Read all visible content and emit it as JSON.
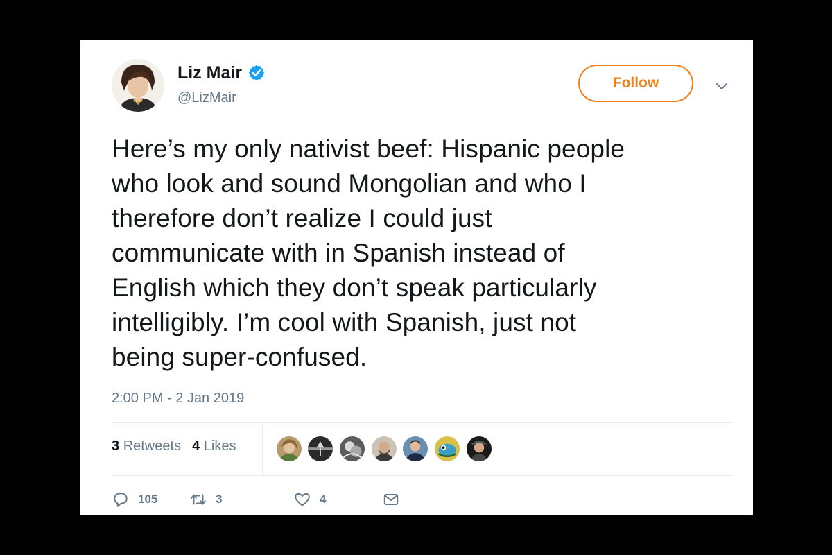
{
  "tweet": {
    "author_name": "Liz Mair",
    "handle": "@LizMair",
    "follow_label": "Follow",
    "text_lines": [
      "Here’s my only nativist beef: Hispanic people",
      "who look and sound Mongolian and who I",
      "therefore don’t realize I could just",
      "communicate with in Spanish instead of",
      "English which they don’t speak particularly",
      "intelligibly. I’m cool with Spanish, just not",
      "being super-confused."
    ],
    "timestamp": "2:00 PM - 2 Jan 2019",
    "stats": {
      "retweets_count": "3",
      "retweets_label": "Retweets",
      "likes_count": "4",
      "likes_label": "Likes"
    },
    "actions": {
      "replies": "105",
      "retweets": "3",
      "likes": "4"
    }
  },
  "colors": {
    "accent": "#f07f1c",
    "verified": "#1da1f2",
    "text": "#14171a",
    "muted": "#657786"
  },
  "icons": [
    "verified-badge-icon",
    "chevron-down-icon",
    "reply-icon",
    "retweet-icon",
    "heart-icon",
    "message-icon"
  ]
}
